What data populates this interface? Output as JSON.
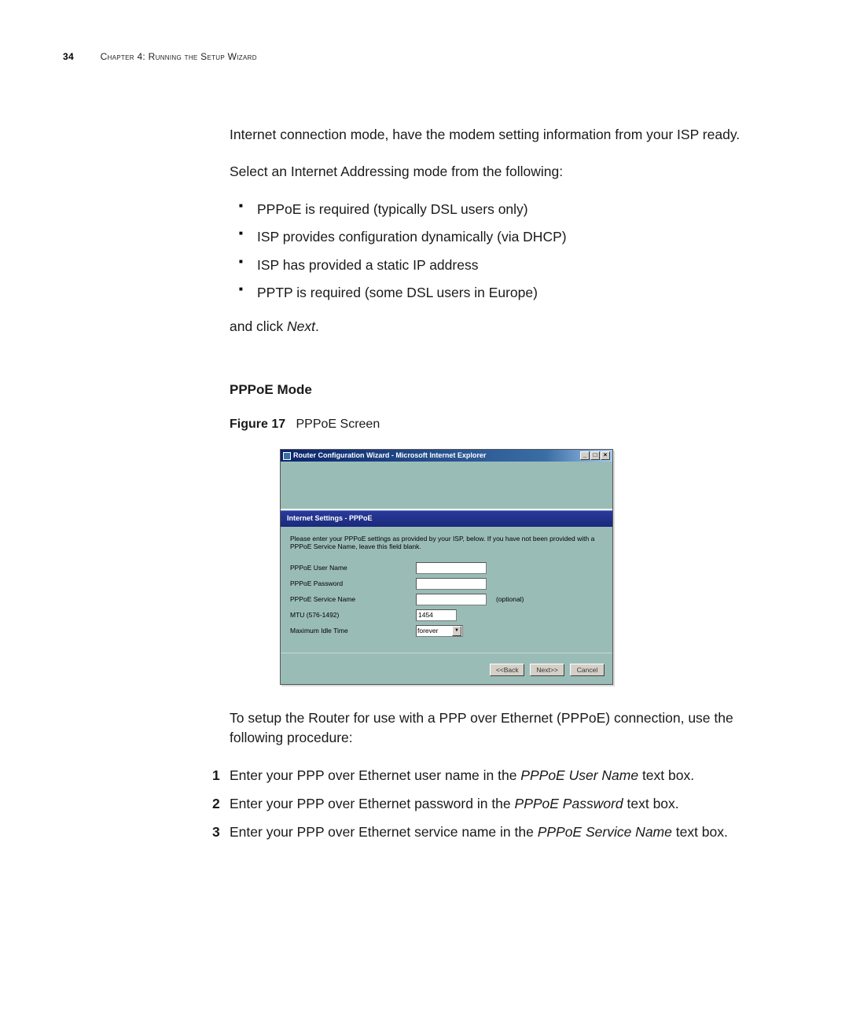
{
  "header": {
    "pageNumber": "34",
    "chapterLabel": "Chapter 4: Running the Setup Wizard"
  },
  "body": {
    "intro1": "Internet connection mode, have the modem setting information from your ISP ready.",
    "intro2": "Select an Internet Addressing mode from the following:",
    "bullets": [
      "PPPoE is required (typically DSL users only)",
      "ISP provides configuration dynamically (via DHCP)",
      "ISP has provided a static IP address",
      "PPTP is required (some DSL users in Europe)"
    ],
    "clickNextPrefix": "and click ",
    "clickNextItalic": "Next",
    "clickNextSuffix": ".",
    "sectionHeading": "PPPoE Mode",
    "figureLabel": "Figure 17",
    "figureCaption": "PPPoE Screen",
    "afterFigure": "To setup the Router for use with a PPP over Ethernet (PPPoE) connection, use the following procedure:",
    "steps": [
      {
        "pre": "Enter your PPP over Ethernet user name in the ",
        "em": "PPPoE User Name",
        "post": " text box."
      },
      {
        "pre": "Enter your PPP over Ethernet password in the ",
        "em": "PPPoE Password",
        "post": " text box."
      },
      {
        "pre": "Enter your PPP over Ethernet service name in the ",
        "em": "PPPoE Service Name",
        "post": " text box."
      }
    ]
  },
  "window": {
    "title": "Router Configuration Wizard - Microsoft Internet Explorer",
    "panelTitle": "Internet Settings - PPPoE",
    "panelDesc": "Please enter your PPPoE settings as provided by your ISP, below. If you have not been provided with a PPPoE Service Name, leave this field blank.",
    "fields": {
      "userNameLabel": "PPPoE User Name",
      "passwordLabel": "PPPoE Password",
      "serviceNameLabel": "PPPoE Service Name",
      "serviceNameNote": "(optional)",
      "mtuLabel": "MTU (576-1492)",
      "mtuValue": "1454",
      "idleLabel": "Maximum Idle Time",
      "idleValue": "forever"
    },
    "buttons": {
      "back": "<<Back",
      "next": "Next>>",
      "cancel": "Cancel"
    },
    "winctrl": {
      "min": "_",
      "max": "□",
      "close": "×"
    }
  }
}
